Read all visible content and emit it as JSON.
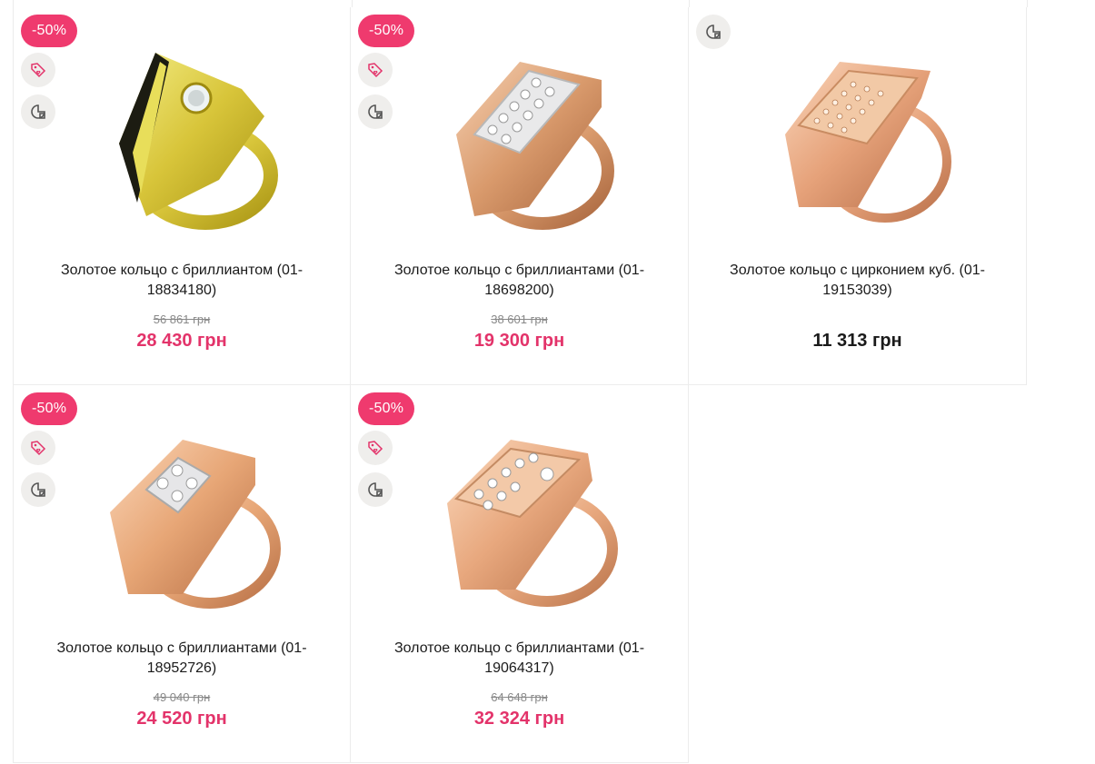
{
  "colors": {
    "sale": "#ef3a6e",
    "sale_price": "#e3336a",
    "icon_bg": "#efeeec"
  },
  "icons": {
    "tag": "tag-heart-icon",
    "compare": "compare-icon"
  },
  "products": [
    {
      "badge": "-50%",
      "title": "Золотое кольцо с бриллиантом (01-18834180)",
      "old_price": "56 861 грн",
      "price": "28 430 грн"
    },
    {
      "badge": "-50%",
      "title": "Золотое кольцо с бриллиантами (01-18698200)",
      "old_price": "38 601 грн",
      "price": "19 300 грн"
    },
    {
      "badge": "",
      "title": "Золотое кольцо с цирконием куб. (01-19153039)",
      "old_price": "",
      "price": "11 313 грн"
    },
    {
      "badge": "-50%",
      "title": "Золотое кольцо с бриллиантами (01-18952726)",
      "old_price": "49 040 грн",
      "price": "24 520 грн"
    },
    {
      "badge": "-50%",
      "title": "Золотое кольцо с бриллиантами (01-19064317)",
      "old_price": "64 648 грн",
      "price": "32 324 грн"
    }
  ]
}
